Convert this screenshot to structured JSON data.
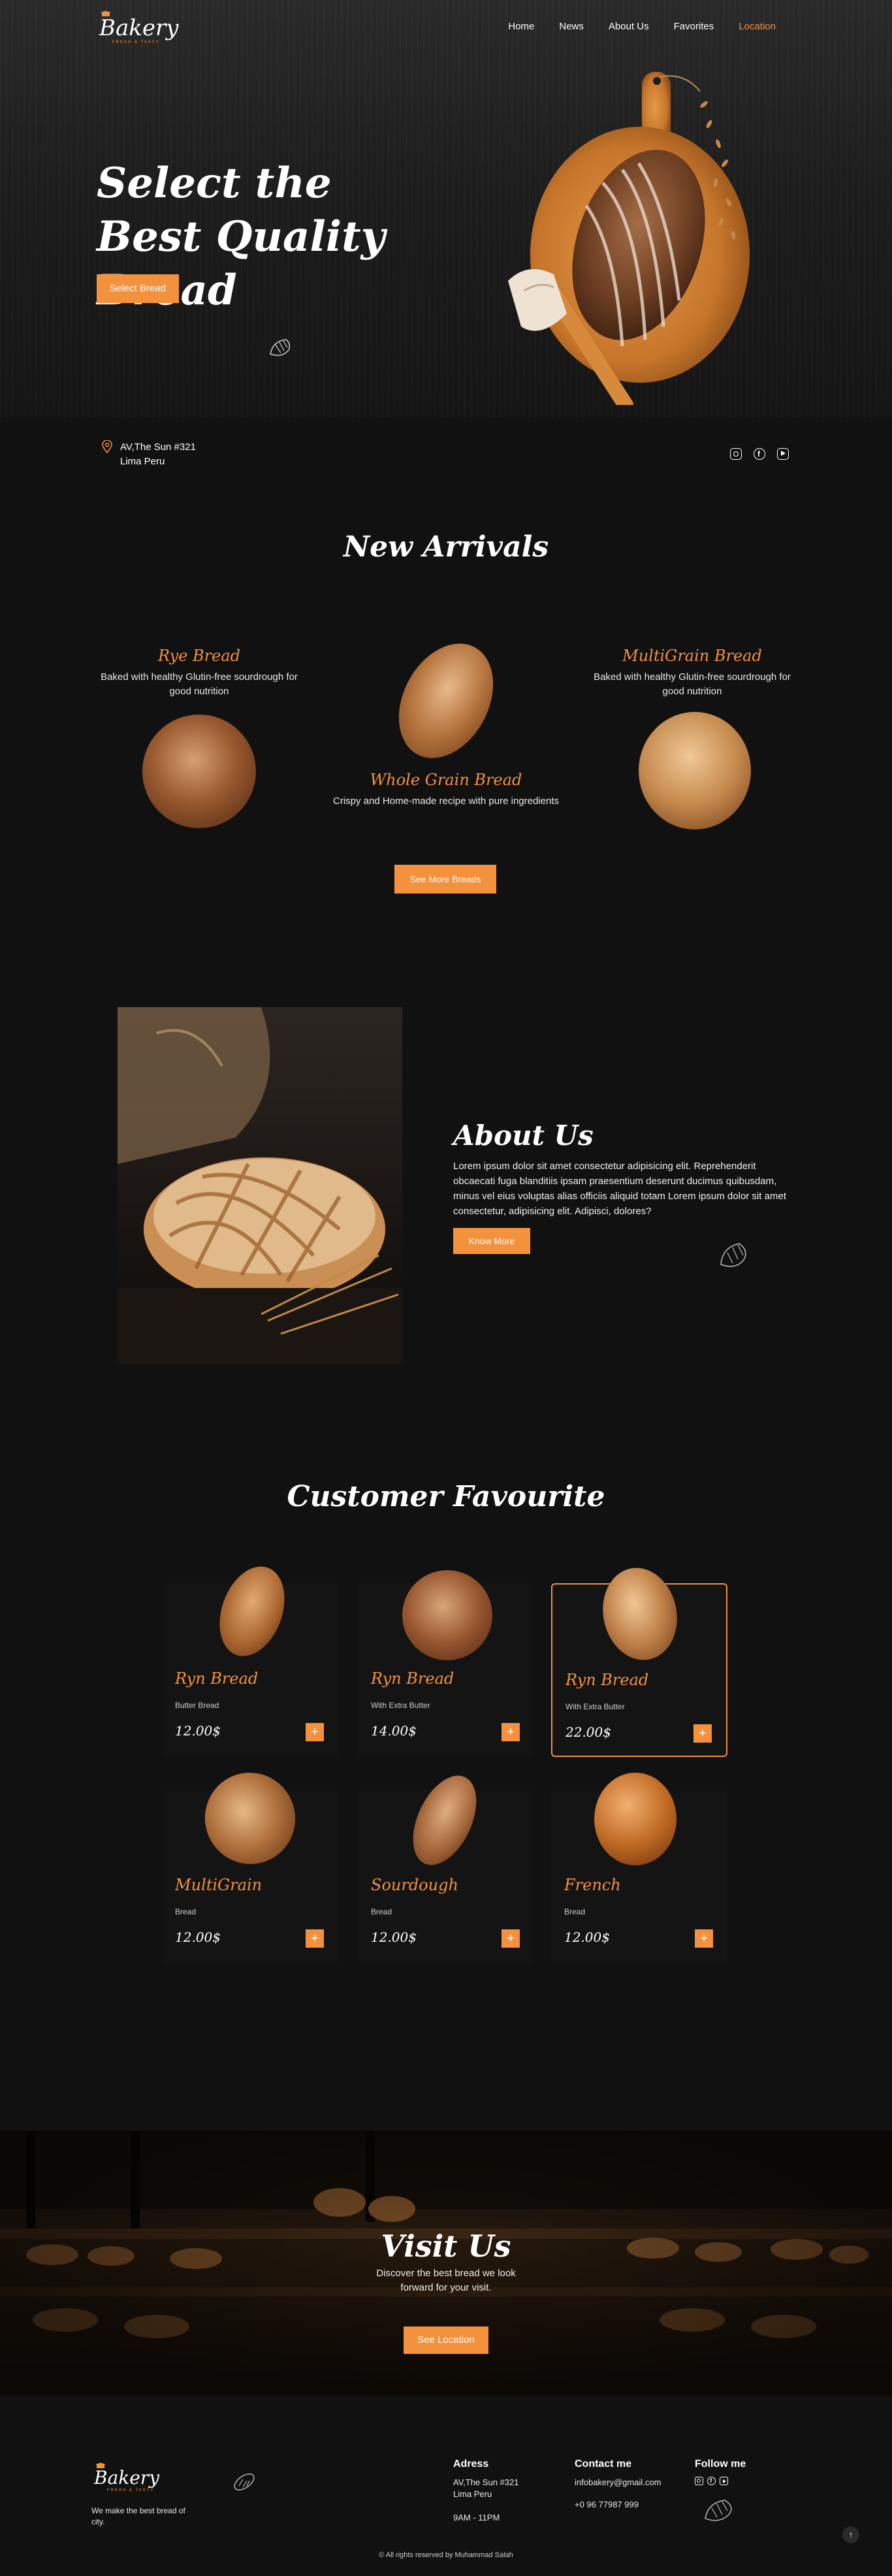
{
  "brand": {
    "name": "Bakery",
    "tagline": "FRESH & TASTY"
  },
  "nav": {
    "items": [
      "Home",
      "News",
      "About Us",
      "Favorites",
      "Location"
    ],
    "active": "Location"
  },
  "hero": {
    "title": "Select the Best Quality Bread",
    "button": "Select Bread"
  },
  "address": {
    "line1": "AV,The Sun #321",
    "line2": "Lima Peru"
  },
  "socials": [
    "instagram-icon",
    "facebook-icon",
    "youtube-icon"
  ],
  "new_arrivals": {
    "title": "New Arrivals",
    "items": [
      {
        "name": "Rye Bread",
        "desc": "Baked with healthy Glutin-free sourdrough for good nutrition"
      },
      {
        "name": "Whole Grain Bread",
        "desc": "Crispy and Home-made recipe with pure ingredients"
      },
      {
        "name": "MultiGrain Bread",
        "desc": "Baked with healthy Glutin-free sourdrough for good nutrition"
      }
    ],
    "button": "See More Breads"
  },
  "about": {
    "title": "About Us",
    "text": "Lorem ipsum dolor sit amet consectetur adipisicing elit. Reprehenderit obcaecati fuga blanditiis ipsam praesentium deserunt ducimus quibusdam, minus vel eius voluptas alias officiis aliquid totam Lorem ipsum dolor sit amet consectetur, adipisicing elit. Adipisci, dolores?",
    "button": "Know More"
  },
  "favourites": {
    "title": "Customer Favourite",
    "items": [
      {
        "name": "Ryn Bread",
        "sub": "Butter Bread",
        "price": "12.00$"
      },
      {
        "name": "Ryn Bread",
        "sub": "With Extra Butter",
        "price": "14.00$"
      },
      {
        "name": "Ryn Bread",
        "sub": "With Extra Butter",
        "price": "22.00$"
      },
      {
        "name": "MultiGrain",
        "sub": "Bread",
        "price": "12.00$"
      },
      {
        "name": "Sourdough",
        "sub": "Bread",
        "price": "12.00$"
      },
      {
        "name": "French",
        "sub": "Bread",
        "price": "12.00$"
      }
    ],
    "add_label": "+"
  },
  "visit": {
    "title": "Visit Us",
    "text": "Discover the best bread we look forward for your visit.",
    "button": "See Location"
  },
  "footer": {
    "tagline": "We make the best bread of city.",
    "address_title": "Adress",
    "address_line1": "AV,The Sun #321",
    "address_line2": "Lima Peru",
    "hours": "9AM - 11PM",
    "contact_title": "Contact me",
    "email": "infobakery@gmail.com",
    "phone": "+0 96 77987 999",
    "follow_title": "Follow me",
    "copyright": "© All rights reserved by Muhammad Salah",
    "top_label": "↑"
  }
}
